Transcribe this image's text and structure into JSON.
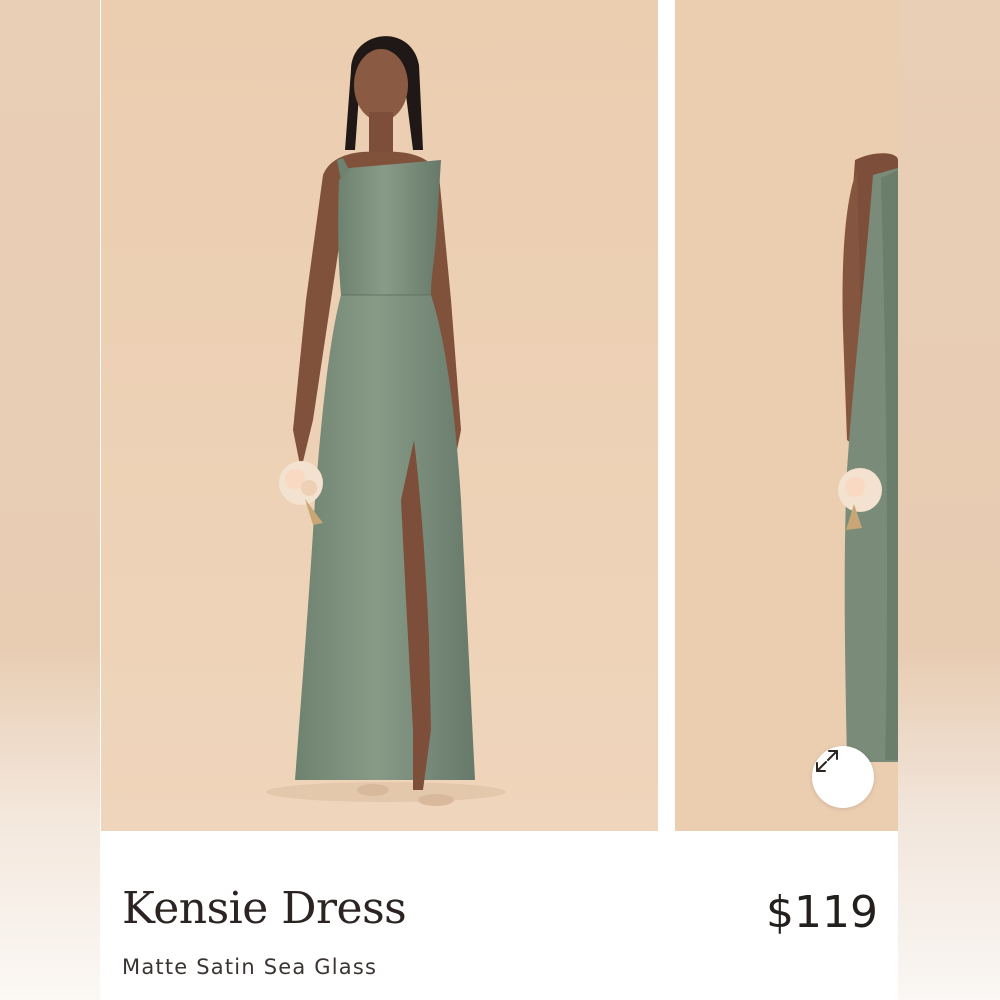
{
  "product": {
    "name": "Kensie Dress",
    "variant": "Matte Satin Sea Glass",
    "price": "$119"
  },
  "gallery": {
    "images": [
      {
        "description_icon": "model-front-photo"
      },
      {
        "description_icon": "model-side-photo"
      }
    ],
    "expand_icon": "expand-arrows-icon"
  },
  "colors": {
    "background": "#eccfb2",
    "dress": "#7a8c79",
    "text": "#2b2422"
  }
}
